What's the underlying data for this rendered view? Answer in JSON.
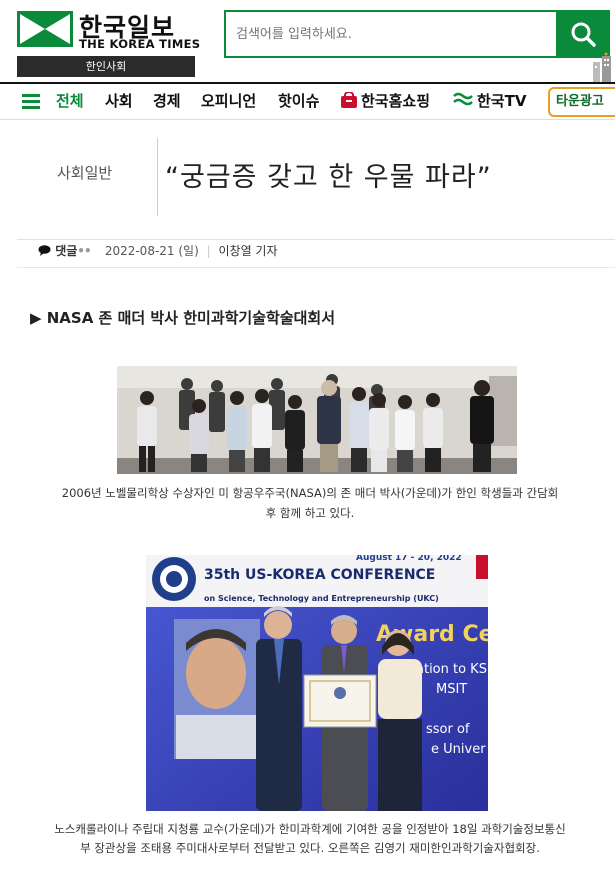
{
  "brand": {
    "name_ko": "한국일보",
    "name_en": "THE KOREA TIMES",
    "section": "한인사회",
    "green": "#0a8a3a"
  },
  "search": {
    "placeholder": "검색어를 입력하세요.",
    "icon": "search-icon"
  },
  "nav": {
    "menu_icon": "hamburger-icon",
    "items": [
      {
        "label": "전체"
      },
      {
        "label": "사회"
      },
      {
        "label": "경제"
      },
      {
        "label": "오피니언"
      },
      {
        "label": "핫이슈"
      },
      {
        "label": "한국홈쇼핑",
        "icon": "shopping-bag-icon"
      },
      {
        "label": "한국TV",
        "icon": "tv-icon"
      }
    ],
    "town_ad": "타운광고"
  },
  "article": {
    "category": "사회일반",
    "headline": "“궁금증 갖고 한 우물 파라”",
    "comments_label": "댓글",
    "date": "2022-08-21 (일)",
    "author": "이창열 기자",
    "subhead": "▶ NASA 존 매더 박사 한미과학기술학술대회서",
    "photo1_caption": "2006년 노벨물리학상 수상자인 미 항공우주국(NASA)의 존 매더 박사(가운데)가 한인 학생들과 간담회 후 함께 하고 있다.",
    "photo2_banner": {
      "dates": "August 17 - 20, 2022",
      "title": "35th US-KOREA CONFERENCE",
      "subtitle": "on Science, Technology and Entrepreneurship (UKC)",
      "award": "Award Ceremo",
      "line1": "ation to KSE",
      "line2": "MSIT",
      "line3": "ssor of",
      "line4": "e Univer"
    },
    "photo2_caption": "노스캐롤라이나 주립대 지청룡 교수(가운데)가 한미과학계에 기여한 공을 인정받아 18일 과학기술정보통신부 장관상을 조태용 주미대사로부터 전달받고 있다. 오른쪽은 김영기 재미한인과학기술자협회장."
  }
}
